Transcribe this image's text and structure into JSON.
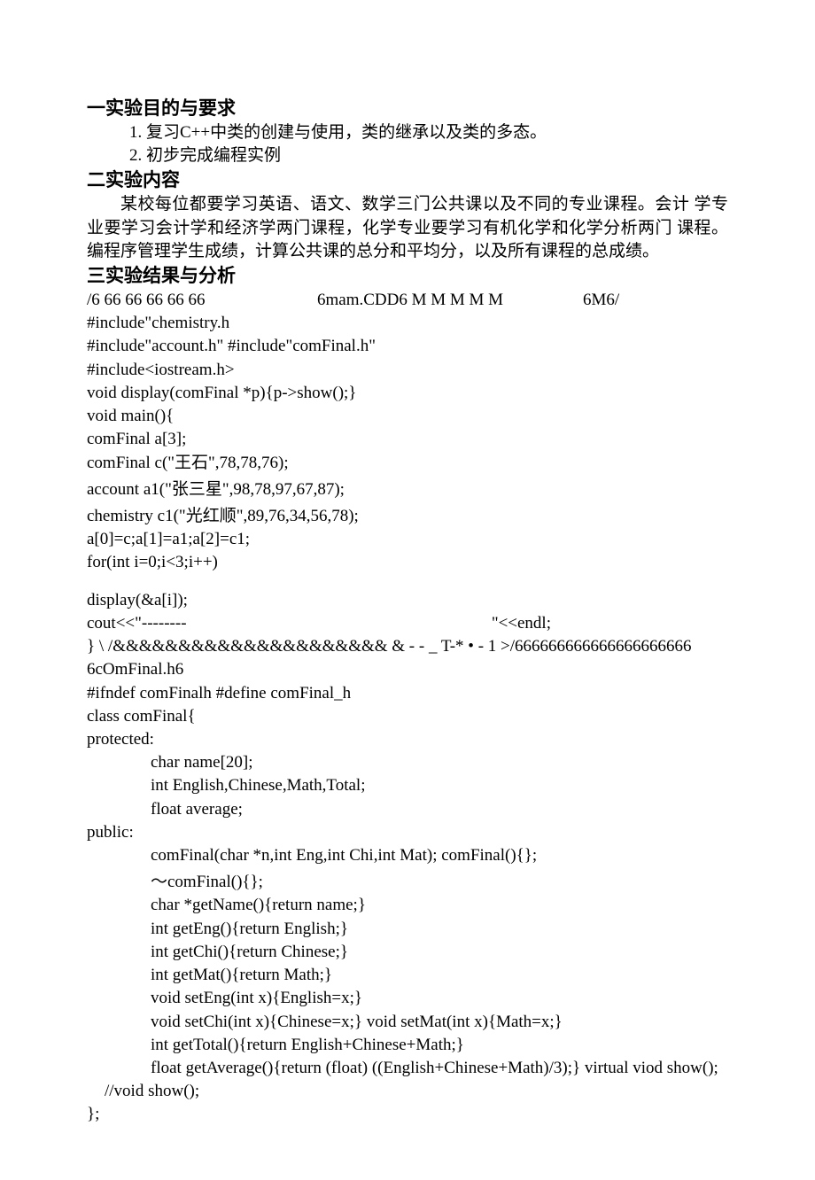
{
  "s1": {
    "heading": "一实验目的与要求",
    "item1": "1. 复习C++中类的创建与使用，类的继承以及类的多态。",
    "item2": "2. 初步完成编程实例"
  },
  "s2": {
    "heading": "二实验内容",
    "body": "某校每位都要学习英语、语文、数学三门公共课以及不同的专业课程。会计 学专业要学习会计学和经济学两门课程，化学专业要学习有机化学和化学分析两门 课程。编程序管理学生成绩，计算公共课的总分和平均分，以及所有课程的总成绩。"
  },
  "s3": {
    "heading": "三实验结果与分析",
    "line1a": "/6 66 66 66 66 66",
    "line1b": "6mam.CDD6 M M M M M",
    "line1c": "6M6/",
    "line2": "#include\"chemistry.h",
    "line3": "#include\"account.h\" #include\"comFinal.h\"",
    "line4": "#include<iostream.h>",
    "line5": "void display(comFinal *p){p->show();}",
    "line6": "void main(){",
    "line7": "comFinal a[3];",
    "line8": "comFinal c(\"王石\",78,78,76);",
    "line9": "account a1(\"张三星\",98,78,97,67,87);",
    "line10": "chemistry c1(\"光红顺\",89,76,34,56,78);",
    "line11": "a[0]=c;a[1]=a1;a[2]=c1;",
    "line12": "for(int i=0;i<3;i++)",
    "line13": "display(&a[i]);",
    "line14a": "cout<<\"--------",
    "line14b": "\"<<endl;",
    "line15": "} \\ /&&&&&&&&&&&&&&&&&&&&& & - - _ T-* •     - 1 >/666666666666666666666 6cOmFinal.h6",
    "line17": "#ifndef comFinalh #define comFinal_h",
    "line18": "class comFinal{",
    "line19": "protected:",
    "line20": "char name[20];",
    "line21": "int English,Chinese,Math,Total;",
    "line22": "float average;",
    "line23": "public:",
    "line24": "comFinal(char *n,int Eng,int Chi,int Mat); comFinal(){};",
    "line25": "〜comFinal(){};",
    "line26": "char *getName(){return name;}",
    "line27": "int getEng(){return English;}",
    "line28": "int getChi(){return Chinese;}",
    "line29": "int getMat(){return Math;}",
    "line30": "void setEng(int x){English=x;}",
    "line31": "void setChi(int x){Chinese=x;} void setMat(int x){Math=x;}",
    "line32": "int getTotal(){return English+Chinese+Math;}",
    "line33": "float getAverage(){return (float) ((English+Chinese+Math)/3);} virtual viod show();",
    "line34": "//void show();",
    "line35": "};"
  }
}
